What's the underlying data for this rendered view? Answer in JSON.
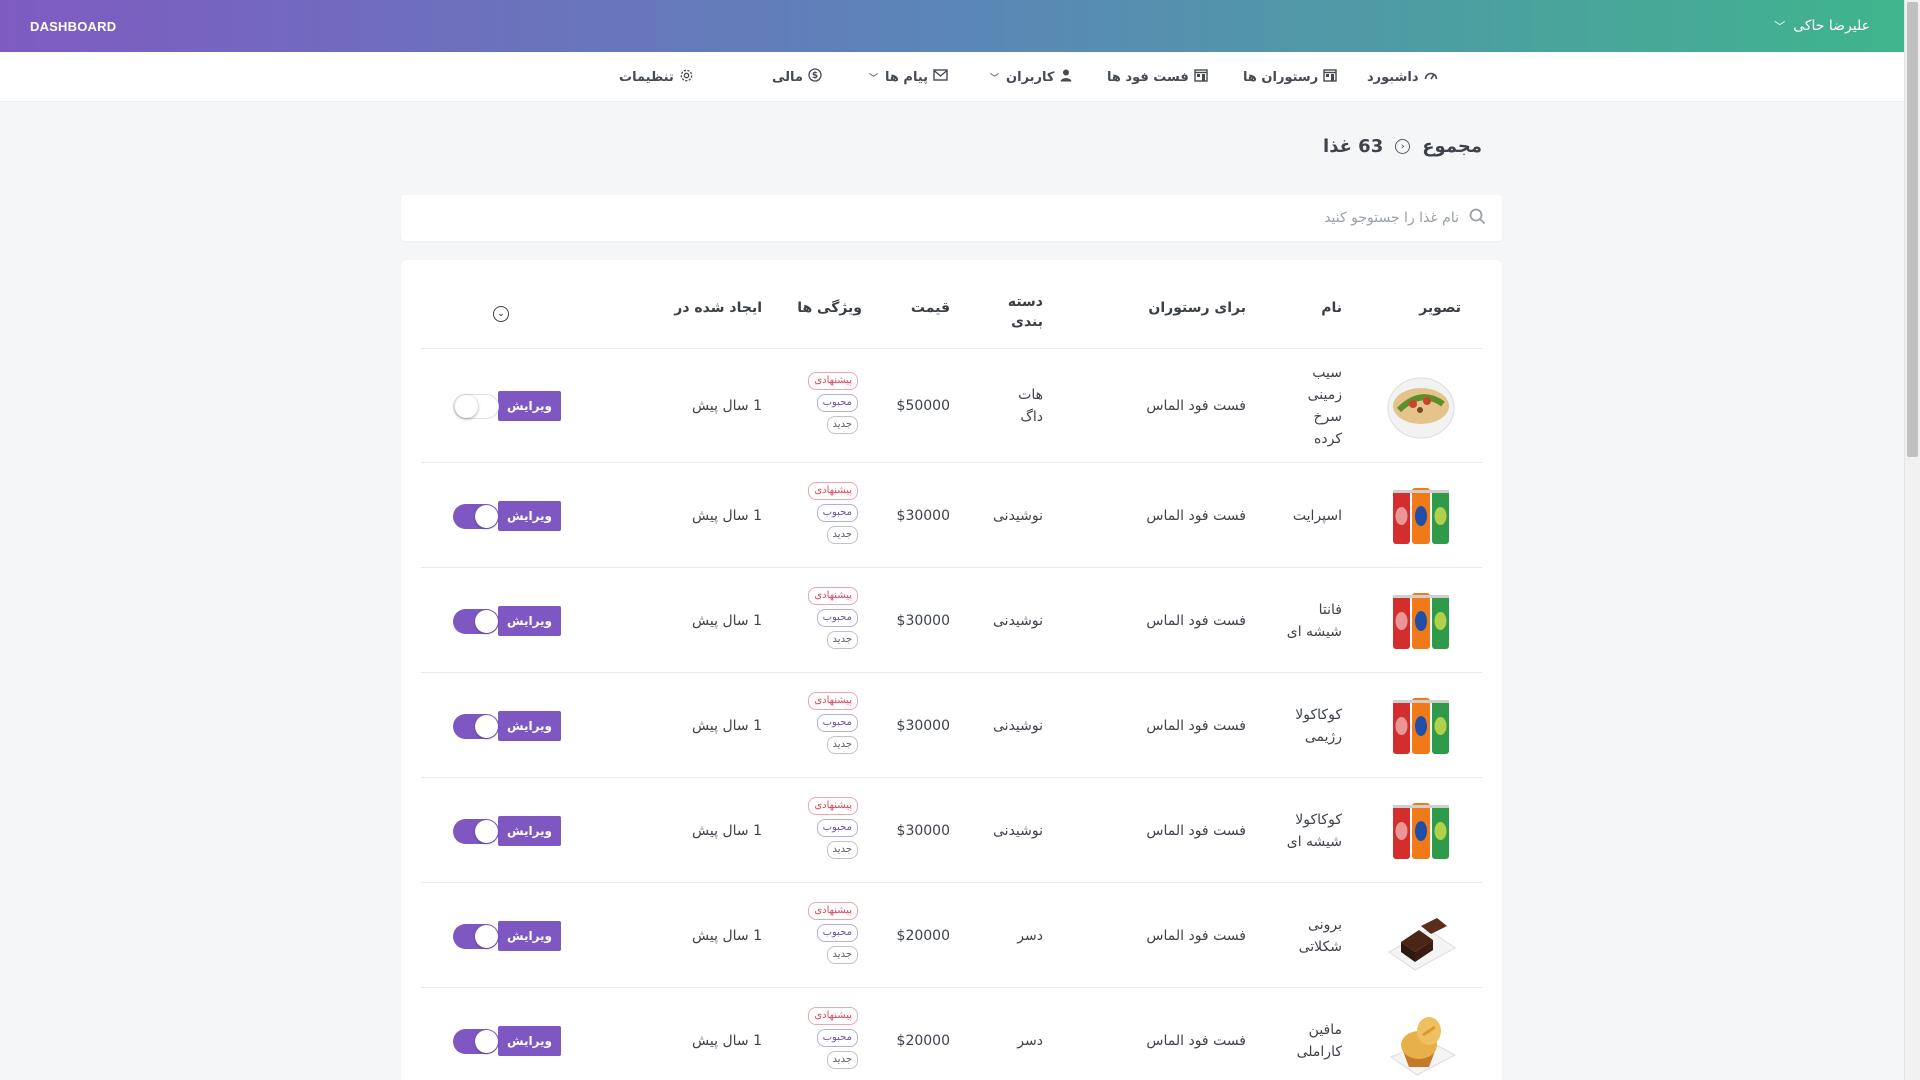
{
  "app": {
    "brand": "DASHBOARD",
    "user_name": "علیرضا حاکی"
  },
  "nav": {
    "dashboard": "داشبورد",
    "restaurants": "رستوران ها",
    "fastfoods": "فست فود ها",
    "users": "کاربران",
    "messages": "پیام ها",
    "finance": "مالی",
    "settings": "تنظیمات"
  },
  "page": {
    "total_label": "مجموع",
    "count_label": "63 غذا"
  },
  "search": {
    "placeholder": "نام غذا را جستوجو کنید"
  },
  "table": {
    "headers": {
      "image": "تصویر",
      "name": "نام",
      "restaurant": "برای رستوران",
      "category": "دسته بندی",
      "price": "قیمت",
      "features": "ویژگی ها",
      "created": "ایجاد شده در"
    },
    "badge_labels": {
      "suggested": "پیشنهادی",
      "popular": "محبوب",
      "new": "جدید"
    },
    "edit_label": "ویرایش",
    "rows": [
      {
        "name": "سیب زمینی سرخ کرده",
        "restaurant": "فست فود الماس",
        "category": "هات داگ",
        "price": "$50000",
        "created": "1 سال پیش",
        "active": false,
        "thumb": "wrap"
      },
      {
        "name": "اسپرایت",
        "restaurant": "فست فود الماس",
        "category": "نوشیدنی",
        "price": "$30000",
        "created": "1 سال پیش",
        "active": true,
        "thumb": "cans"
      },
      {
        "name": "فانتا شیشه ای",
        "restaurant": "فست فود الماس",
        "category": "نوشیدنی",
        "price": "$30000",
        "created": "1 سال پیش",
        "active": true,
        "thumb": "cans"
      },
      {
        "name": "کوکاکولا رژیمی",
        "restaurant": "فست فود الماس",
        "category": "نوشیدنی",
        "price": "$30000",
        "created": "1 سال پیش",
        "active": true,
        "thumb": "cans"
      },
      {
        "name": "کوکاکولا شیشه ای",
        "restaurant": "فست فود الماس",
        "category": "نوشیدنی",
        "price": "$30000",
        "created": "1 سال پیش",
        "active": true,
        "thumb": "cans"
      },
      {
        "name": "برونی شکلاتی",
        "restaurant": "فست فود الماس",
        "category": "دسر",
        "price": "$20000",
        "created": "1 سال پیش",
        "active": true,
        "thumb": "brownie"
      },
      {
        "name": "مافین کاراملی",
        "restaurant": "فست فود الماس",
        "category": "دسر",
        "price": "$20000",
        "created": "1 سال پیش",
        "active": true,
        "thumb": "muffin"
      }
    ]
  }
}
